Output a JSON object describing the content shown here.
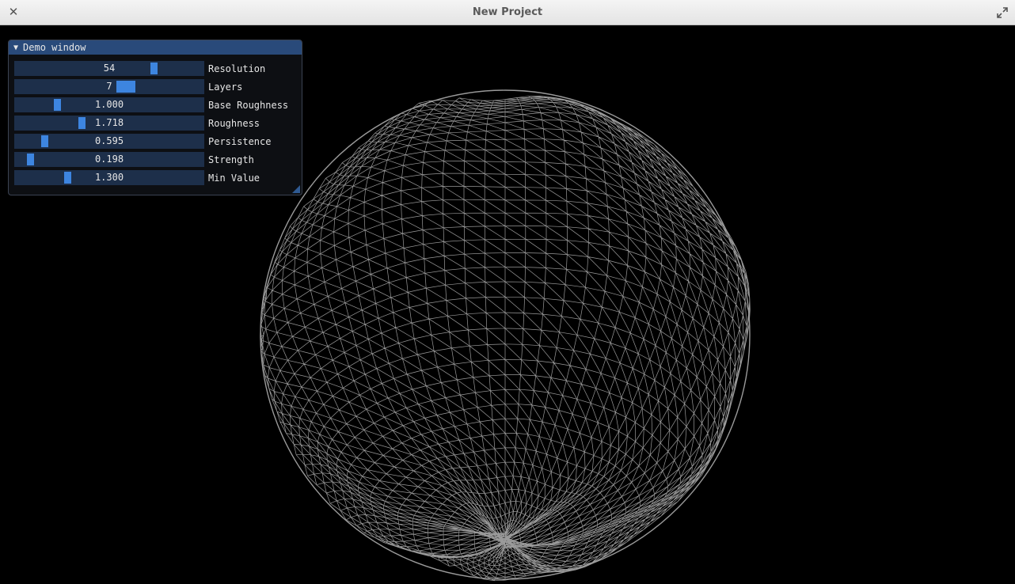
{
  "window": {
    "title": "New Project",
    "close_glyph": "✕"
  },
  "demo_window": {
    "title": "Demo window",
    "arrow_glyph": "▼",
    "sliders": [
      {
        "label": "Resolution",
        "value": "54",
        "fraction": 0.75,
        "grab_width": 9
      },
      {
        "label": "Layers",
        "value": "7",
        "fraction": 0.6,
        "grab_width": 24
      },
      {
        "label": "Base Roughness",
        "value": "1.000",
        "fraction": 0.21,
        "grab_width": 9
      },
      {
        "label": "Roughness",
        "value": "1.718",
        "fraction": 0.35,
        "grab_width": 9
      },
      {
        "label": "Persistence",
        "value": "0.595",
        "fraction": 0.14,
        "grab_width": 9
      },
      {
        "label": "Strength",
        "value": "0.198",
        "fraction": 0.06,
        "grab_width": 9
      },
      {
        "label": "Min Value",
        "value": "1.300",
        "fraction": 0.27,
        "grab_width": 9
      }
    ]
  },
  "colors": {
    "wireframe": "#9a9a9a",
    "slider_grab": "#3d85e0",
    "header": "#294a7a"
  }
}
